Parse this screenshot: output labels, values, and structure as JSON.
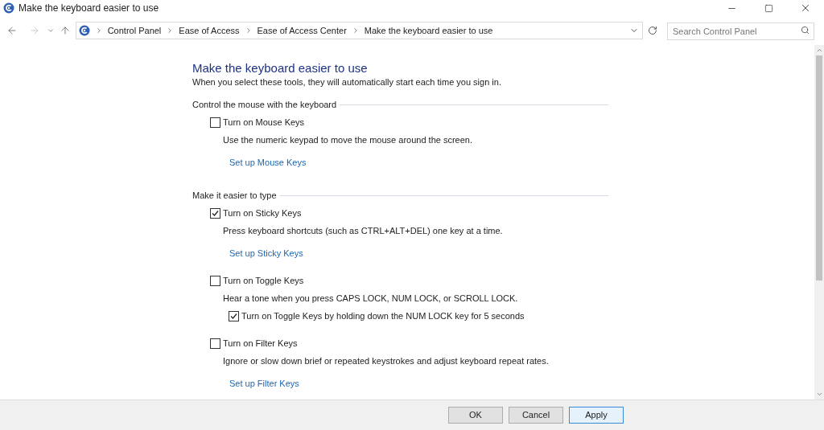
{
  "window": {
    "title": "Make the keyboard easier to use"
  },
  "breadcrumbs": [
    "Control Panel",
    "Ease of Access",
    "Ease of Access Center",
    "Make the keyboard easier to use"
  ],
  "search": {
    "placeholder": "Search Control Panel"
  },
  "page": {
    "title": "Make the keyboard easier to use",
    "subtitle": "When you select these tools, they will automatically start each time you sign in."
  },
  "sections": [
    {
      "heading": "Control the mouse with the keyboard",
      "items": [
        {
          "kind": "checkbox",
          "label": "Turn on Mouse Keys",
          "checked": false
        },
        {
          "kind": "text",
          "label": "Use the numeric keypad to move the mouse around the screen."
        },
        {
          "kind": "link",
          "label": "Set up Mouse Keys"
        }
      ]
    },
    {
      "heading": "Make it easier to type",
      "items": [
        {
          "kind": "checkbox",
          "label": "Turn on Sticky Keys",
          "checked": true
        },
        {
          "kind": "text",
          "label": "Press keyboard shortcuts (such as CTRL+ALT+DEL) one key at a time."
        },
        {
          "kind": "link",
          "label": "Set up Sticky Keys"
        },
        {
          "kind": "checkbox",
          "label": "Turn on Toggle Keys",
          "checked": false
        },
        {
          "kind": "text",
          "label": "Hear a tone when you press CAPS LOCK, NUM LOCK, or SCROLL LOCK."
        },
        {
          "kind": "subcheckbox",
          "label": "Turn on Toggle Keys by holding down the NUM LOCK key for 5 seconds",
          "checked": true
        },
        {
          "kind": "checkbox",
          "label": "Turn on Filter Keys",
          "checked": false
        },
        {
          "kind": "text",
          "label": "Ignore or slow down brief or repeated keystrokes and adjust keyboard repeat rates."
        },
        {
          "kind": "link",
          "label": "Set up Filter Keys"
        }
      ]
    }
  ],
  "buttons": [
    {
      "label": "OK",
      "selected": false
    },
    {
      "label": "Cancel",
      "selected": false
    },
    {
      "label": "Apply",
      "selected": true
    }
  ]
}
